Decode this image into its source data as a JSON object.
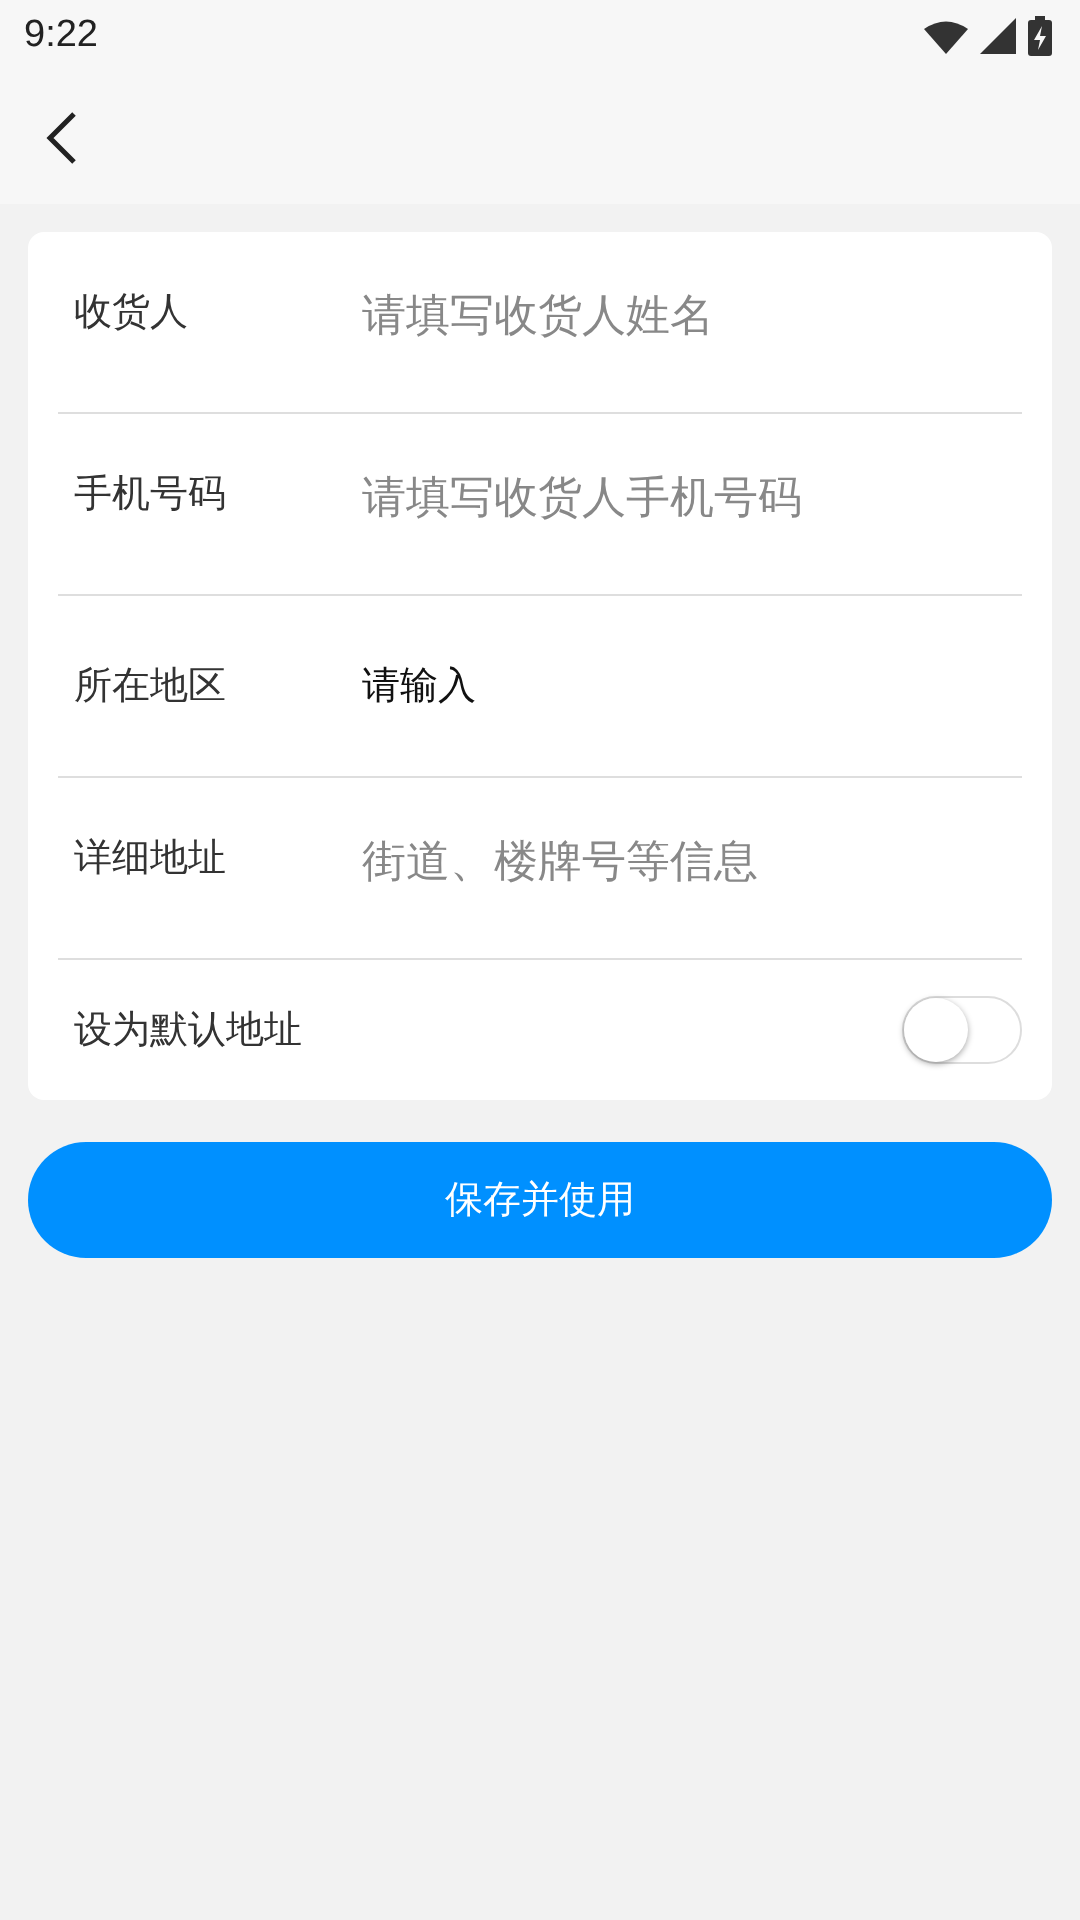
{
  "status_bar": {
    "time": "9:22"
  },
  "fields": [
    {
      "kind": "input",
      "label": "收货人",
      "placeholder": "请填写收货人姓名"
    },
    {
      "kind": "input",
      "label": "手机号码",
      "placeholder": "请填写收货人手机号码"
    },
    {
      "kind": "picker",
      "label": "所在地区",
      "value": "请输入"
    },
    {
      "kind": "input",
      "label": "详细地址",
      "placeholder": "街道、楼牌号等信息"
    }
  ],
  "default_address": {
    "label": "设为默认地址",
    "on": false
  },
  "submit_button": "保存并使用"
}
